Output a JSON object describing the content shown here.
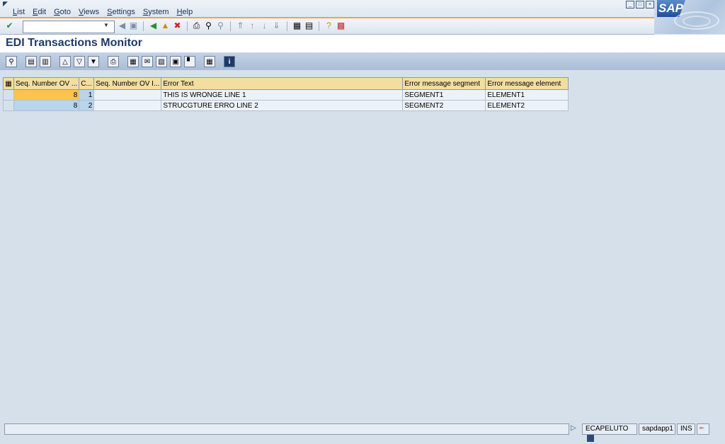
{
  "menu": {
    "items": [
      "List",
      "Edit",
      "Goto",
      "Views",
      "Settings",
      "System",
      "Help"
    ]
  },
  "toolbar": {
    "command_value": ""
  },
  "page": {
    "title": "EDI Transactions Monitor"
  },
  "table": {
    "headers": [
      "Seq. Number OV ...",
      "C...",
      "Seq. Number OV I...",
      "Error Text",
      "Error message segment",
      "Error message element"
    ],
    "rows": [
      [
        "8",
        "1",
        "",
        "THIS IS WRONGE LINE 1",
        "SEGMENT1",
        "ELEMENT1"
      ],
      [
        "8",
        "2",
        "",
        "STRUCGTURE ERRO LINE 2",
        "SEGMENT2",
        "ELEMENT2"
      ]
    ]
  },
  "status": {
    "user": "ECAPELUTO",
    "server": "sapdapp1",
    "mode": "INS"
  },
  "brand": {
    "logo_text": "SAP"
  },
  "colors": {
    "accent": "#e8a648",
    "header_bg": "#f3dea0",
    "title": "#1e3a6a"
  }
}
